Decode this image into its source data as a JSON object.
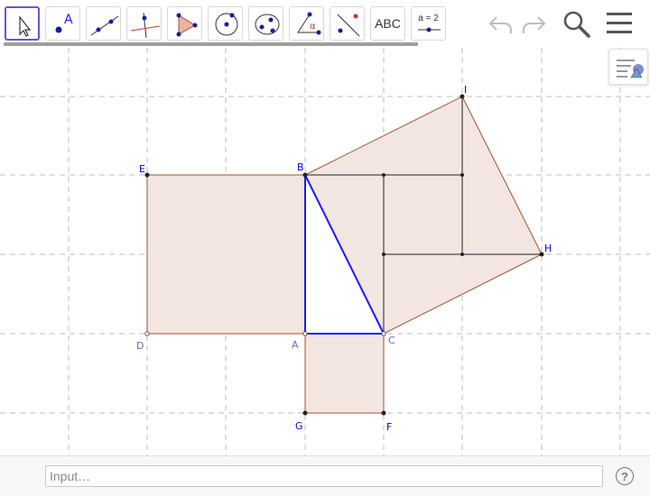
{
  "toolbar": {
    "tools": [
      {
        "name": "Move",
        "icon": "pointer-arrow-icon",
        "active": true
      },
      {
        "name": "Point",
        "icon": "point-icon",
        "glyph": "A"
      },
      {
        "name": "Line",
        "icon": "line-icon"
      },
      {
        "name": "Perpendicular Line",
        "icon": "perpendicular-line-icon"
      },
      {
        "name": "Polygon",
        "icon": "polygon-icon"
      },
      {
        "name": "Circle with Center through Point",
        "icon": "circle-center-icon"
      },
      {
        "name": "Ellipse",
        "icon": "ellipse-icon"
      },
      {
        "name": "Angle",
        "icon": "angle-icon",
        "glyph": "α"
      },
      {
        "name": "Reflect about Line",
        "icon": "reflect-icon"
      },
      {
        "name": "Text",
        "icon": "text-icon",
        "label": "ABC"
      },
      {
        "name": "Slider",
        "icon": "slider-icon",
        "label": "a = 2"
      }
    ],
    "undo_icon": "undo-icon",
    "redo_icon": "redo-icon",
    "search_icon": "search-icon",
    "menu_icon": "menu-icon"
  },
  "style_bar_icon": "style-bar-toggle-icon",
  "points": {
    "A": "A",
    "B": "B",
    "C": "C",
    "D": "D",
    "E": "E",
    "F": "F",
    "G": "G",
    "H": "H",
    "I": "I"
  },
  "input_bar": {
    "placeholder": "Input…",
    "help_label": "?"
  },
  "colors": {
    "polygon_fill": "#f3e6e1",
    "polygon_edge": "#a0522d",
    "triangle_edge": "#1a1aff",
    "grid": "#bdbdbd",
    "point": "#222222",
    "label": "#0000cc",
    "active_tool_border": "#6557d2"
  }
}
